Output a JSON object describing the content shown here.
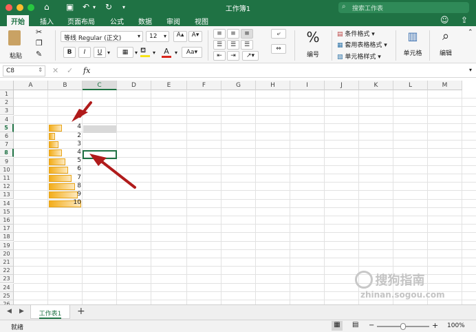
{
  "window": {
    "title": "工作簿1",
    "search_placeholder": "搜索工作表"
  },
  "tabs": [
    "开始",
    "插入",
    "页面布局",
    "公式",
    "数据",
    "审阅",
    "视图"
  ],
  "ribbon": {
    "paste_label": "粘贴",
    "font_name": "等线 Regular (正文)",
    "font_size": "12",
    "bold": "B",
    "italic": "I",
    "underline": "U",
    "number_label": "编号",
    "percent_symbol": "%",
    "conditional_format": "条件格式",
    "table_format": "套用表格格式",
    "cell_styles": "单元格样式",
    "cells_label": "单元格",
    "editing_label": "编辑"
  },
  "formula_bar": {
    "name_box": "C8",
    "fx": "fx",
    "value": ""
  },
  "columns": [
    "A",
    "B",
    "C",
    "D",
    "E",
    "F",
    "G",
    "H",
    "I",
    "J",
    "K",
    "L",
    "M"
  ],
  "rows": [
    "1",
    "2",
    "3",
    "4",
    "5",
    "6",
    "7",
    "8",
    "9",
    "10",
    "11",
    "12",
    "13",
    "14",
    "15",
    "16",
    "17",
    "18",
    "19",
    "20",
    "21",
    "22",
    "23",
    "24",
    "25",
    "26"
  ],
  "cells": [
    {
      "row": "5",
      "value": "4"
    },
    {
      "row": "6",
      "value": "2"
    },
    {
      "row": "7",
      "value": "3"
    },
    {
      "row": "8",
      "value": "4"
    },
    {
      "row": "9",
      "value": "5"
    },
    {
      "row": "10",
      "value": "6"
    },
    {
      "row": "11",
      "value": "7"
    },
    {
      "row": "12",
      "value": "8"
    },
    {
      "row": "13",
      "value": "9"
    },
    {
      "row": "14",
      "value": "10"
    }
  ],
  "active_cell": "C8",
  "sheet_tab": "工作表1",
  "add_sheet": "+",
  "status": {
    "ready": "就绪",
    "zoom": "100%",
    "minus": "−",
    "plus": "+"
  },
  "watermark": {
    "line1": "搜狗指南",
    "line2": "zhinan.sogou.com"
  },
  "colors": {
    "accent": "#1f7244",
    "databar": "#f3ad1a",
    "arrow": "#b01b1b"
  }
}
